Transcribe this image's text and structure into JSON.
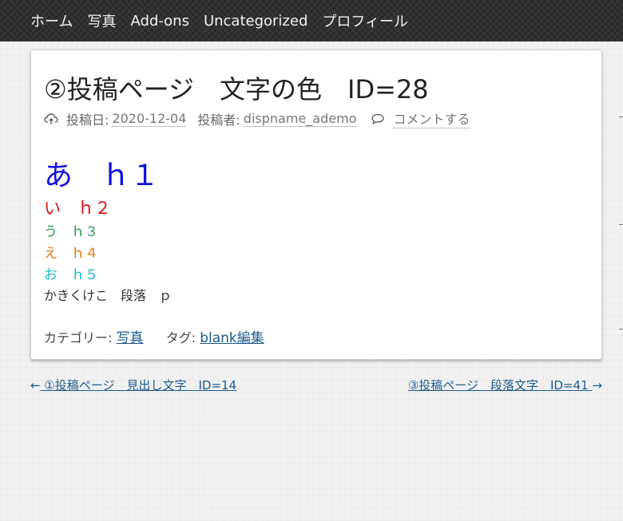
{
  "nav": {
    "items": [
      {
        "label": "ホーム"
      },
      {
        "label": "写真"
      },
      {
        "label": "Add-ons"
      },
      {
        "label": "Uncategorized"
      },
      {
        "label": "プロフィール"
      }
    ]
  },
  "post": {
    "title": "②投稿ページ　文字の色　ID=28",
    "meta": {
      "date_label": "投稿日:",
      "date": "2020-12-04",
      "author_label": "投稿者:",
      "author": "dispname_ademo",
      "comment": "コメントする"
    },
    "content": {
      "h1": "あ　ｈ１",
      "h2": "い　ｈ２",
      "h3": "う　ｈ３",
      "h4": "え　ｈ４",
      "h5": "お　ｈ５",
      "p": "かきくけこ　段落　ｐ"
    },
    "footer": {
      "category_label": "カテゴリー:",
      "category": "写真",
      "tag_label": "タグ:",
      "tag": "blank編集"
    }
  },
  "post_nav": {
    "prev_arrow": "←",
    "prev": "①投稿ページ　見出し文字　ID=14",
    "next": "③投稿ページ　段落文字　ID=41",
    "next_arrow": "→"
  },
  "colors": {
    "h1": "#1010e0",
    "h2": "#e01010",
    "h3": "#2e9a4f",
    "h4": "#e87a14",
    "h5": "#18b7cf",
    "link": "#1d5a8f",
    "nav_bg": "#2b2b2b"
  },
  "icons": {
    "date": "cloud-upload-icon",
    "comment": "speech-bubble-icon"
  }
}
